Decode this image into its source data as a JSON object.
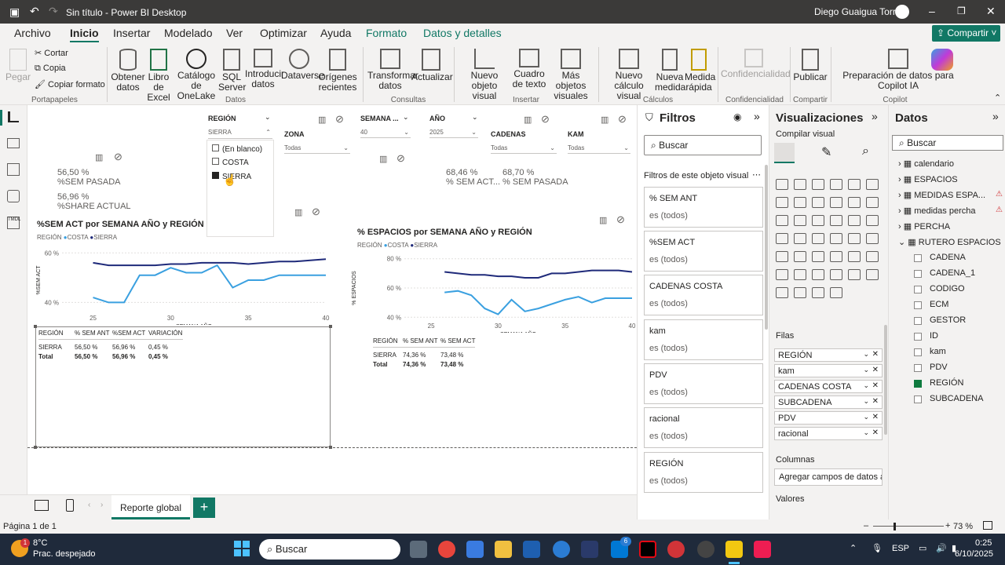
{
  "titlebar": {
    "title": "Sin título - Power BI Desktop",
    "user": "Diego Guaigua Torres"
  },
  "menu": [
    "Archivo",
    "Inicio",
    "Insertar",
    "Modelado",
    "Ver",
    "Optimizar",
    "Ayuda",
    "Formato",
    "Datos y detalles"
  ],
  "share_label": "Compartir",
  "ribbon": {
    "paste": "Pegar",
    "cut": "Cortar",
    "copy": "Copia",
    "format_painter": "Copiar formato",
    "btns": [
      "Obtener datos",
      "Libro de Excel",
      "Catálogo de OneLake",
      "SQL Server",
      "Introducir datos",
      "Dataverse",
      "Orígenes recientes",
      "Transformar datos",
      "Actualizar",
      "Nuevo objeto visual",
      "Cuadro de texto",
      "Más objetos visuales",
      "Nuevo cálculo visual",
      "Nueva medida",
      "Medida rápida",
      "Confidencialidad",
      "Publicar",
      "Preparación de datos para Copilot IA"
    ],
    "groups": [
      "Portapapeles",
      "Datos",
      "Consultas",
      "Insertar",
      "Cálculos",
      "Confidencialidad",
      "Compartir",
      "Copilot"
    ]
  },
  "slicers": {
    "region": {
      "title": "REGIÓN",
      "value": "SIERRA",
      "options": [
        "(En blanco)",
        "COSTA",
        "SIERRA"
      ]
    },
    "zona": {
      "title": "ZONA",
      "value": "Todas"
    },
    "semana": {
      "title": "SEMANA ...",
      "value": "40"
    },
    "anio": {
      "title": "AÑO",
      "value": "2025"
    },
    "cadenas": {
      "title": "CADENAS",
      "value": "Todas"
    },
    "kam": {
      "title": "KAM",
      "value": "Todas"
    }
  },
  "cards": {
    "left": [
      {
        "v": "56,50 %",
        "l": "%SEM PASADA"
      },
      {
        "v": "56,96 %",
        "l": "%SHARE ACTUAL"
      }
    ],
    "right": [
      {
        "v": "68,46 %",
        "l": "% SEM ACT..."
      },
      {
        "v": "68,70 %",
        "l": "% SEM PASADA"
      }
    ]
  },
  "chart1": {
    "title": "%SEM ACT por SEMANA AÑO y REGIÓN",
    "legend_title": "REGIÓN",
    "ylabel": "%SEM ACT",
    "xlabel": "SEMANA AÑO",
    "yticks": [
      "60 %",
      "40 %"
    ]
  },
  "chart2": {
    "title": "% ESPACIOS por SEMANA AÑO y REGIÓN",
    "legend_title": "REGIÓN",
    "ylabel": "% ESPACIOS",
    "xlabel": "SEMANA AÑO",
    "yticks": [
      "80 %",
      "60 %",
      "40 %"
    ]
  },
  "chart_data": [
    {
      "type": "line",
      "title": "%SEM ACT por SEMANA AÑO y REGIÓN",
      "xlabel": "SEMANA AÑO",
      "ylabel": "%SEM ACT",
      "xlim": [
        23,
        40
      ],
      "ylim": [
        36,
        62
      ],
      "x": [
        24,
        25,
        26,
        27,
        28,
        29,
        30,
        31,
        32,
        33,
        34,
        35,
        36,
        37,
        38,
        39,
        40
      ],
      "series": [
        {
          "name": "COSTA",
          "color": "#3aa0e0",
          "values": [
            null,
            42,
            40,
            40,
            51,
            51,
            54,
            52,
            52,
            55,
            46,
            49,
            49,
            51,
            51,
            51,
            51
          ]
        },
        {
          "name": "SIERRA",
          "color": "#1f2a7a",
          "values": [
            null,
            56,
            55,
            55,
            55,
            55,
            55.5,
            55.5,
            56,
            56,
            56,
            55.5,
            56,
            56.5,
            56.5,
            57,
            57.5
          ]
        }
      ]
    },
    {
      "type": "line",
      "title": "% ESPACIOS por SEMANA AÑO y REGIÓN",
      "xlabel": "SEMANA AÑO",
      "ylabel": "% ESPACIOS",
      "xlim": [
        23,
        40
      ],
      "ylim": [
        38,
        82
      ],
      "x": [
        24,
        25,
        26,
        27,
        28,
        29,
        30,
        31,
        32,
        33,
        34,
        35,
        36,
        37,
        38,
        39,
        40
      ],
      "series": [
        {
          "name": "COSTA",
          "color": "#3aa0e0",
          "values": [
            null,
            null,
            57,
            58,
            55,
            46,
            42,
            52,
            44,
            46,
            49,
            52,
            54,
            50,
            53,
            53,
            53
          ]
        },
        {
          "name": "SIERRA",
          "color": "#1f2a7a",
          "values": [
            null,
            null,
            71,
            70,
            69,
            69,
            68,
            68,
            67,
            67,
            70,
            70,
            71,
            72,
            72,
            72,
            71
          ]
        }
      ]
    },
    {
      "type": "table",
      "columns": [
        "REGIÓN",
        "% SEM ANT",
        "%SEM ACT",
        "VARIACIÓN"
      ],
      "rows": [
        [
          "SIERRA",
          "56,50 %",
          "56,96 %",
          "0,45 %"
        ],
        [
          "Total",
          "56,50 %",
          "56,96 %",
          "0,45 %"
        ]
      ]
    },
    {
      "type": "table",
      "columns": [
        "REGIÓN",
        "% SEM ANT",
        "% SEM ACT"
      ],
      "rows": [
        [
          "SIERRA",
          "74,36 %",
          "73,48 %"
        ],
        [
          "Total",
          "74,36 %",
          "73,48 %"
        ]
      ]
    }
  ],
  "legend": [
    "COSTA",
    "SIERRA"
  ],
  "filters": {
    "title": "Filtros",
    "search": "Buscar",
    "section": "Filtros de este objeto visual",
    "cards": [
      {
        "n": "% SEM ANT",
        "v": "es (todos)"
      },
      {
        "n": "%SEM ACT",
        "v": "es (todos)"
      },
      {
        "n": "CADENAS COSTA",
        "v": "es (todos)"
      },
      {
        "n": "kam",
        "v": "es (todos)"
      },
      {
        "n": "PDV",
        "v": "es (todos)"
      },
      {
        "n": "racional",
        "v": "es (todos)"
      },
      {
        "n": "REGIÓN",
        "v": "es (todos)"
      }
    ]
  },
  "viz": {
    "title": "Visualizaciones",
    "build": "Compilar visual",
    "rows_label": "Filas",
    "columns_label": "Columnas",
    "columns_hint": "Agregar campos de datos a...",
    "values_label": "Valores",
    "wells": [
      "REGIÓN",
      "kam",
      "CADENAS COSTA",
      "SUBCADENA",
      "PDV",
      "racional"
    ]
  },
  "data": {
    "title": "Datos",
    "search": "Buscar",
    "tables": [
      "calendario",
      "ESPACIOS",
      "MEDIDAS ESPA...",
      "medidas percha",
      "PERCHA",
      "RUTERO ESPACIOS"
    ],
    "fields": [
      "CADENA",
      "CADENA_1",
      "CODIGO",
      "ECM",
      "GESTOR",
      "ID",
      "kam",
      "PDV",
      "REGIÓN",
      "SUBCADENA"
    ],
    "checked": "REGIÓN"
  },
  "page_tab": "Reporte global",
  "status": {
    "page": "Página 1 de 1",
    "zoom": "73 %"
  },
  "taskbar": {
    "temp": "8°C",
    "weather": "Prac. despejado",
    "search": "Buscar",
    "lang": "ESP",
    "time": "0:25",
    "date": "6/10/2025",
    "badge": "1",
    "badge2": "6"
  }
}
